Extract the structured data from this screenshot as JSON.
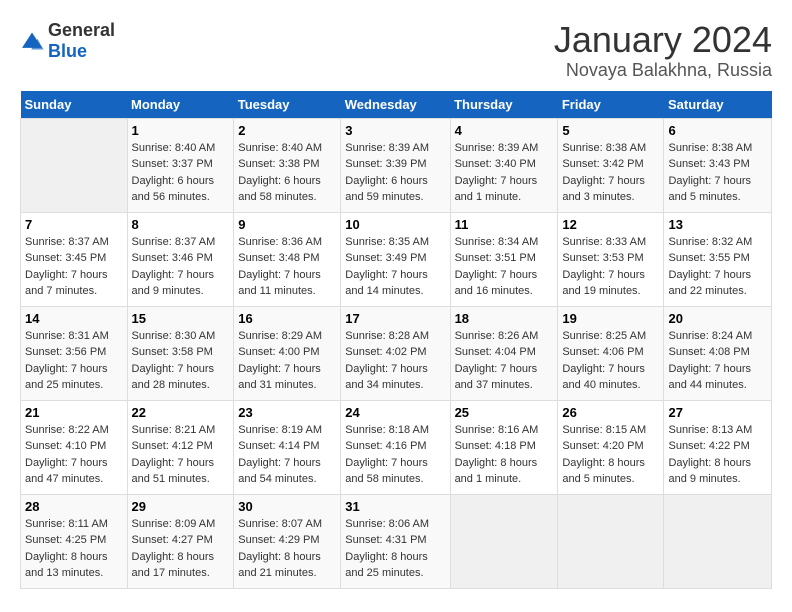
{
  "logo": {
    "general": "General",
    "blue": "Blue"
  },
  "header": {
    "title": "January 2024",
    "subtitle": "Novaya Balakhna, Russia"
  },
  "days_of_week": [
    "Sunday",
    "Monday",
    "Tuesday",
    "Wednesday",
    "Thursday",
    "Friday",
    "Saturday"
  ],
  "weeks": [
    [
      {
        "day": "",
        "sunrise": "",
        "sunset": "",
        "daylight": "",
        "empty": true
      },
      {
        "day": "1",
        "sunrise": "Sunrise: 8:40 AM",
        "sunset": "Sunset: 3:37 PM",
        "daylight": "Daylight: 6 hours and 56 minutes."
      },
      {
        "day": "2",
        "sunrise": "Sunrise: 8:40 AM",
        "sunset": "Sunset: 3:38 PM",
        "daylight": "Daylight: 6 hours and 58 minutes."
      },
      {
        "day": "3",
        "sunrise": "Sunrise: 8:39 AM",
        "sunset": "Sunset: 3:39 PM",
        "daylight": "Daylight: 6 hours and 59 minutes."
      },
      {
        "day": "4",
        "sunrise": "Sunrise: 8:39 AM",
        "sunset": "Sunset: 3:40 PM",
        "daylight": "Daylight: 7 hours and 1 minute."
      },
      {
        "day": "5",
        "sunrise": "Sunrise: 8:38 AM",
        "sunset": "Sunset: 3:42 PM",
        "daylight": "Daylight: 7 hours and 3 minutes."
      },
      {
        "day": "6",
        "sunrise": "Sunrise: 8:38 AM",
        "sunset": "Sunset: 3:43 PM",
        "daylight": "Daylight: 7 hours and 5 minutes."
      }
    ],
    [
      {
        "day": "7",
        "sunrise": "Sunrise: 8:37 AM",
        "sunset": "Sunset: 3:45 PM",
        "daylight": "Daylight: 7 hours and 7 minutes."
      },
      {
        "day": "8",
        "sunrise": "Sunrise: 8:37 AM",
        "sunset": "Sunset: 3:46 PM",
        "daylight": "Daylight: 7 hours and 9 minutes."
      },
      {
        "day": "9",
        "sunrise": "Sunrise: 8:36 AM",
        "sunset": "Sunset: 3:48 PM",
        "daylight": "Daylight: 7 hours and 11 minutes."
      },
      {
        "day": "10",
        "sunrise": "Sunrise: 8:35 AM",
        "sunset": "Sunset: 3:49 PM",
        "daylight": "Daylight: 7 hours and 14 minutes."
      },
      {
        "day": "11",
        "sunrise": "Sunrise: 8:34 AM",
        "sunset": "Sunset: 3:51 PM",
        "daylight": "Daylight: 7 hours and 16 minutes."
      },
      {
        "day": "12",
        "sunrise": "Sunrise: 8:33 AM",
        "sunset": "Sunset: 3:53 PM",
        "daylight": "Daylight: 7 hours and 19 minutes."
      },
      {
        "day": "13",
        "sunrise": "Sunrise: 8:32 AM",
        "sunset": "Sunset: 3:55 PM",
        "daylight": "Daylight: 7 hours and 22 minutes."
      }
    ],
    [
      {
        "day": "14",
        "sunrise": "Sunrise: 8:31 AM",
        "sunset": "Sunset: 3:56 PM",
        "daylight": "Daylight: 7 hours and 25 minutes."
      },
      {
        "day": "15",
        "sunrise": "Sunrise: 8:30 AM",
        "sunset": "Sunset: 3:58 PM",
        "daylight": "Daylight: 7 hours and 28 minutes."
      },
      {
        "day": "16",
        "sunrise": "Sunrise: 8:29 AM",
        "sunset": "Sunset: 4:00 PM",
        "daylight": "Daylight: 7 hours and 31 minutes."
      },
      {
        "day": "17",
        "sunrise": "Sunrise: 8:28 AM",
        "sunset": "Sunset: 4:02 PM",
        "daylight": "Daylight: 7 hours and 34 minutes."
      },
      {
        "day": "18",
        "sunrise": "Sunrise: 8:26 AM",
        "sunset": "Sunset: 4:04 PM",
        "daylight": "Daylight: 7 hours and 37 minutes."
      },
      {
        "day": "19",
        "sunrise": "Sunrise: 8:25 AM",
        "sunset": "Sunset: 4:06 PM",
        "daylight": "Daylight: 7 hours and 40 minutes."
      },
      {
        "day": "20",
        "sunrise": "Sunrise: 8:24 AM",
        "sunset": "Sunset: 4:08 PM",
        "daylight": "Daylight: 7 hours and 44 minutes."
      }
    ],
    [
      {
        "day": "21",
        "sunrise": "Sunrise: 8:22 AM",
        "sunset": "Sunset: 4:10 PM",
        "daylight": "Daylight: 7 hours and 47 minutes."
      },
      {
        "day": "22",
        "sunrise": "Sunrise: 8:21 AM",
        "sunset": "Sunset: 4:12 PM",
        "daylight": "Daylight: 7 hours and 51 minutes."
      },
      {
        "day": "23",
        "sunrise": "Sunrise: 8:19 AM",
        "sunset": "Sunset: 4:14 PM",
        "daylight": "Daylight: 7 hours and 54 minutes."
      },
      {
        "day": "24",
        "sunrise": "Sunrise: 8:18 AM",
        "sunset": "Sunset: 4:16 PM",
        "daylight": "Daylight: 7 hours and 58 minutes."
      },
      {
        "day": "25",
        "sunrise": "Sunrise: 8:16 AM",
        "sunset": "Sunset: 4:18 PM",
        "daylight": "Daylight: 8 hours and 1 minute."
      },
      {
        "day": "26",
        "sunrise": "Sunrise: 8:15 AM",
        "sunset": "Sunset: 4:20 PM",
        "daylight": "Daylight: 8 hours and 5 minutes."
      },
      {
        "day": "27",
        "sunrise": "Sunrise: 8:13 AM",
        "sunset": "Sunset: 4:22 PM",
        "daylight": "Daylight: 8 hours and 9 minutes."
      }
    ],
    [
      {
        "day": "28",
        "sunrise": "Sunrise: 8:11 AM",
        "sunset": "Sunset: 4:25 PM",
        "daylight": "Daylight: 8 hours and 13 minutes."
      },
      {
        "day": "29",
        "sunrise": "Sunrise: 8:09 AM",
        "sunset": "Sunset: 4:27 PM",
        "daylight": "Daylight: 8 hours and 17 minutes."
      },
      {
        "day": "30",
        "sunrise": "Sunrise: 8:07 AM",
        "sunset": "Sunset: 4:29 PM",
        "daylight": "Daylight: 8 hours and 21 minutes."
      },
      {
        "day": "31",
        "sunrise": "Sunrise: 8:06 AM",
        "sunset": "Sunset: 4:31 PM",
        "daylight": "Daylight: 8 hours and 25 minutes."
      },
      {
        "day": "",
        "sunrise": "",
        "sunset": "",
        "daylight": "",
        "empty": true
      },
      {
        "day": "",
        "sunrise": "",
        "sunset": "",
        "daylight": "",
        "empty": true
      },
      {
        "day": "",
        "sunrise": "",
        "sunset": "",
        "daylight": "",
        "empty": true
      }
    ]
  ]
}
